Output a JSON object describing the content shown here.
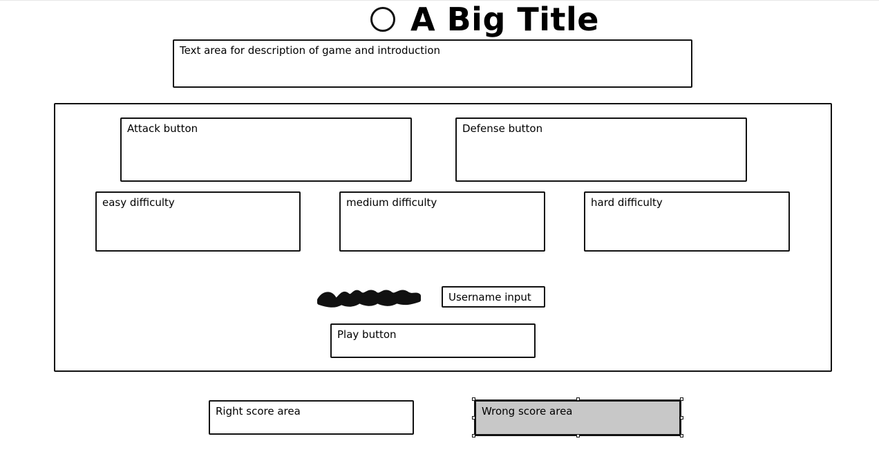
{
  "title": "A Big Title",
  "description_placeholder": "Text area for description of game and introduction",
  "controls": {
    "attack_label": "Attack button",
    "defense_label": "Defense button",
    "easy_label": "easy difficulty",
    "medium_label": "medium difficulty",
    "hard_label": "hard difficulty",
    "username_label": "Username input",
    "play_label": "Play button"
  },
  "scores": {
    "right_label": "Right score area",
    "wrong_label": "Wrong score area"
  },
  "icons": {
    "title_icon": "circle-icon",
    "username_icon": "scribble-icon"
  },
  "colors": {
    "stroke": "#111111",
    "selected_fill": "#c8c8c8",
    "background": "#ffffff"
  }
}
